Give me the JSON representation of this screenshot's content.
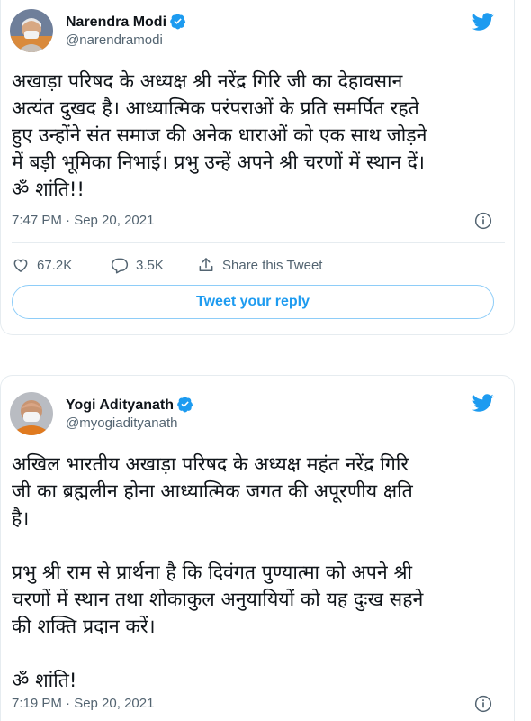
{
  "tweets": [
    {
      "author": "Narendra Modi",
      "handle": "@narendramodi",
      "text_lines": [
        "अखाड़ा परिषद के अध्यक्ष श्री नरेंद्र गिरि जी का देहावसान",
        "अत्यंत दुखद है। आध्यात्मिक परंपराओं के प्रति समर्पित रहते",
        "हुए उन्होंने संत समाज की अनेक धाराओं को एक साथ जोड़ने",
        "में बड़ी भूमिका निभाई। प्रभु उन्हें अपने श्री चरणों में स्थान दें।",
        "ॐ शांति!!"
      ],
      "timestamp": "7:47 PM · Sep 20, 2021",
      "likes": "67.2K",
      "replies": "3.5K",
      "share_label": "Share this Tweet",
      "reply_button": "Tweet your reply"
    },
    {
      "author": "Yogi Adityanath",
      "handle": "@myogiadityanath",
      "paragraph1": [
        "अखिल भारतीय अखाड़ा परिषद के अध्यक्ष महंत नरेंद्र गिरि",
        "जी का ब्रह्मलीन होना आध्यात्मिक जगत की अपूरणीय क्षति",
        "है।"
      ],
      "paragraph2": [
        "प्रभु श्री राम से प्रार्थना है कि दिवंगत पुण्यात्मा को अपने श्री",
        "चरणों में स्थान तथा शोकाकुल अनुयायियों को यह दुःख सहने",
        "की शक्ति प्रदान करें।"
      ],
      "paragraph3": "ॐ शांति!",
      "timestamp": "7:19 PM · Sep 20, 2021"
    }
  ],
  "colors": {
    "twitter_blue": "#1d9bf0",
    "text": "#0f1419",
    "muted": "#536471",
    "border": "#e6ecf0"
  },
  "icons": {
    "bird": "twitter-bird-icon",
    "verified": "verified-badge-icon",
    "info": "info-icon",
    "like": "heart-icon",
    "reply": "reply-bubble-icon",
    "share": "share-icon"
  }
}
